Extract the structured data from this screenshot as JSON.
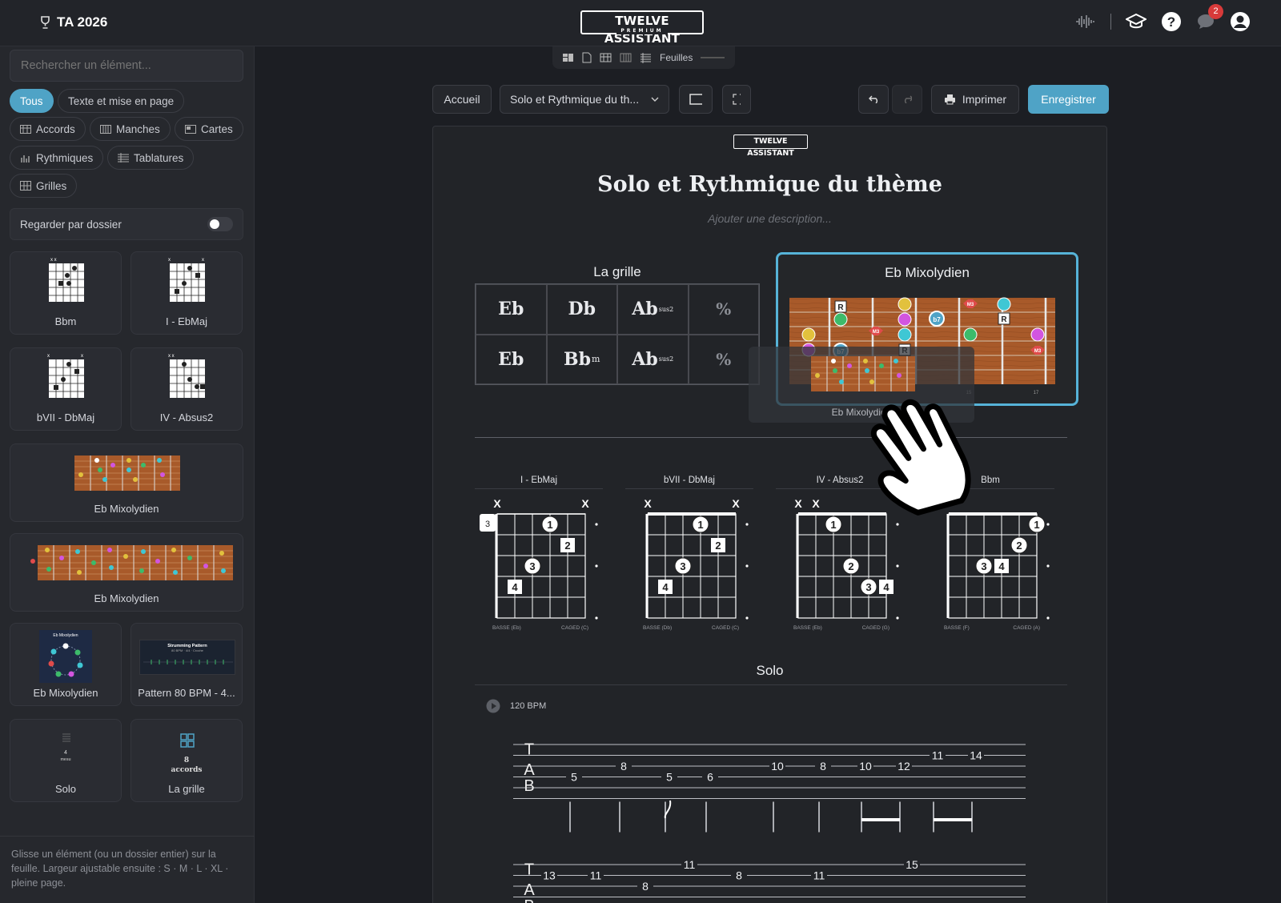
{
  "topbar": {
    "app_name": "TA 2026",
    "brand": "TWELVE ASSISTANT",
    "brand_sub": "PREMIUM",
    "notification_count": "2"
  },
  "sidebar": {
    "search_placeholder": "Rechercher un élément...",
    "filters": [
      "Tous",
      "Texte et mise en page",
      "Accords",
      "Manches",
      "Cartes",
      "Rythmiques",
      "Tablatures",
      "Grilles"
    ],
    "folder_toggle_label": "Regarder par dossier",
    "cards": [
      {
        "label": "Bbm"
      },
      {
        "label": "I - EbMaj"
      },
      {
        "label": "bVII - DbMaj"
      },
      {
        "label": "IV - Absus2"
      },
      {
        "label": "Eb Mixolydien"
      },
      {
        "label": "Eb Mixolydien"
      },
      {
        "label": "Eb Mixolydien",
        "thumb_title": "Eb Mixolydien"
      },
      {
        "label": "Pattern 80 BPM - 4...",
        "thumb_title": "Strumming Pattern",
        "thumb_sub": "80 BPM · 4/4 · Croche"
      },
      {
        "label": "Solo",
        "thumb_count": "4",
        "thumb_word": "mesu"
      },
      {
        "label": "La grille",
        "thumb_count": "8",
        "thumb_word": "accords"
      }
    ],
    "hint": "Glisse un élément (ou un dossier entier) sur la feuille. Largeur ajustable ensuite : S · M · L · XL · pleine page."
  },
  "editor": {
    "mini_tab_label": "Feuilles",
    "home_button": "Accueil",
    "sheet_select": "Solo et Rythmique du th...",
    "print_button": "Imprimer",
    "save_button": "Enregistrer"
  },
  "sheet": {
    "logo": "TWELVE ASSISTANT",
    "title": "Solo et Rythmique du thème",
    "description_placeholder": "Ajouter une description...",
    "grid": {
      "title": "La grille",
      "rows": [
        [
          {
            "root": "Eb",
            "suffix": ""
          },
          {
            "root": "Db",
            "suffix": ""
          },
          {
            "root": "Ab",
            "suffix": "sus2"
          },
          {
            "root": "%",
            "suffix": ""
          }
        ],
        [
          {
            "root": "Eb",
            "suffix": ""
          },
          {
            "root": "Bb",
            "suffix": "m"
          },
          {
            "root": "Ab",
            "suffix": "sus2"
          },
          {
            "root": "%",
            "suffix": ""
          }
        ]
      ]
    },
    "scale_card": {
      "title": "Eb Mixolydien",
      "drag_label": "Eb Mixolydien",
      "fret_marker": "17",
      "fret_marker_prev": "15"
    },
    "chord_diagrams": [
      {
        "name": "I - EbMaj",
        "mutes": [
          "X",
          "",
          "",
          "",
          "",
          "X"
        ],
        "start_fret": "3",
        "bass": "BASSE (Eb)",
        "caged": "CAGED (C)"
      },
      {
        "name": "bVII - DbMaj",
        "mutes": [
          "X",
          "",
          "",
          "",
          "",
          "X"
        ],
        "start_fret": "",
        "bass": "BASSE (Db)",
        "caged": "CAGED (C)"
      },
      {
        "name": "IV - Absus2",
        "mutes": [
          "X",
          "X",
          "",
          "",
          "",
          ""
        ],
        "start_fret": "",
        "bass": "BASSE (Eb)",
        "caged": "CAGED (G)"
      },
      {
        "name": "Bbm",
        "mutes": [
          "",
          "",
          "",
          "",
          "",
          ""
        ],
        "start_fret": "",
        "bass": "BASSE (F)",
        "caged": "CAGED (A)"
      }
    ],
    "solo": {
      "title": "Solo",
      "bpm": "120 BPM",
      "tab_clef": [
        "T",
        "A",
        "B"
      ],
      "staff1_notes": [
        {
          "string": 3,
          "fret": "5"
        },
        {
          "string": 2,
          "fret": "8"
        },
        {
          "string": 3,
          "fret": "5"
        },
        {
          "string": 3,
          "fret": "6"
        },
        {
          "string": 2,
          "fret": "10"
        },
        {
          "string": 2,
          "fret": "8"
        },
        {
          "string": 2,
          "fret": "10"
        },
        {
          "string": 2,
          "fret": "12"
        },
        {
          "string": 1,
          "fret": "11"
        },
        {
          "string": 1,
          "fret": "14"
        }
      ],
      "staff2_notes": [
        {
          "string": 1,
          "fret": "13"
        },
        {
          "string": 1,
          "fret": "11"
        },
        {
          "string": 2,
          "fret": "8"
        },
        {
          "string": 0,
          "fret": "11"
        },
        {
          "string": 1,
          "fret": "8"
        },
        {
          "string": 1,
          "fret": "11"
        },
        {
          "string": 0,
          "fret": "15"
        }
      ]
    }
  },
  "colors": {
    "accent": "#4fa3c6",
    "badge": "#d83a3a",
    "wood": "#a85a2a"
  }
}
